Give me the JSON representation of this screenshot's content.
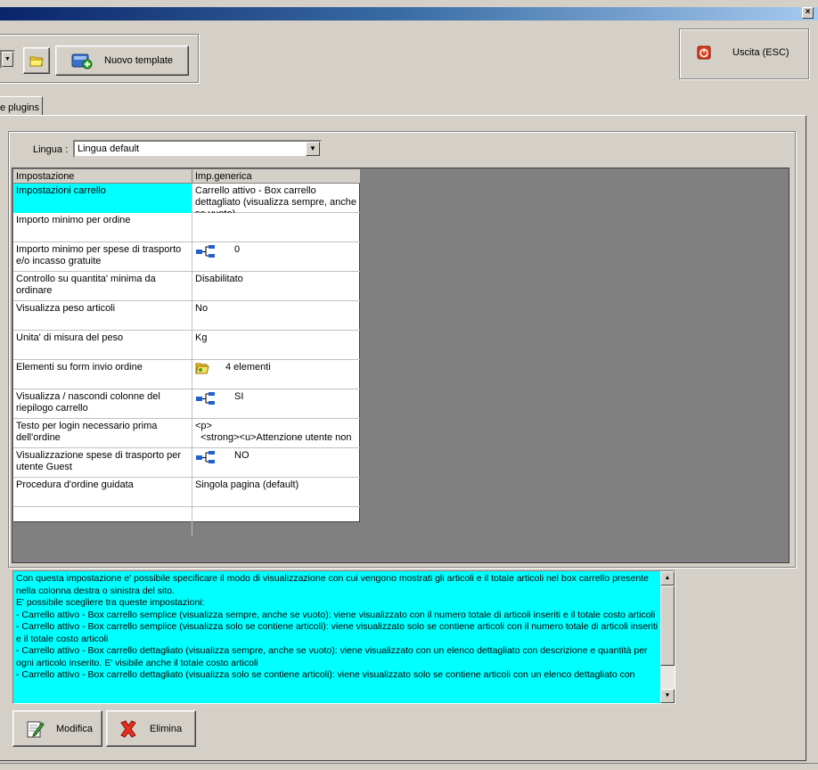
{
  "toolbar": {
    "new_template_label": "Nuovo template",
    "exit_label": "Uscita (ESC)"
  },
  "tabs": [
    {
      "label": "e plugins"
    }
  ],
  "language": {
    "label": "Lingua :",
    "value": "Lingua default"
  },
  "grid": {
    "columns": [
      "Impostazione",
      "Imp.generica"
    ],
    "rows": [
      {
        "setting": "Impostazioni carrello",
        "value": "Carrello attivo - Box carrello dettagliato (visualizza sempre, anche se vuoto)",
        "icon": ""
      },
      {
        "setting": "Importo minimo per ordine",
        "value": "",
        "icon": ""
      },
      {
        "setting": "Importo minimo per spese di trasporto e/o incasso gratuite",
        "value": "0",
        "icon": "tree-icon"
      },
      {
        "setting": "Controllo su quantita' minima da ordinare",
        "value": "Disabilitato",
        "icon": ""
      },
      {
        "setting": "Visualizza peso articoli",
        "value": "No",
        "icon": ""
      },
      {
        "setting": "Unita' di misura del peso",
        "value": "Kg",
        "icon": ""
      },
      {
        "setting": "Elementi su form invio ordine",
        "value": "4 elementi",
        "icon": "folder-icon"
      },
      {
        "setting": "Visualizza / nascondi colonne del riepilogo carrello",
        "value": "SI",
        "icon": "tree-icon"
      },
      {
        "setting": "Testo per login necessario prima dell'ordine",
        "value": "<p>\n  <strong><u>Attenzione utente non",
        "icon": ""
      },
      {
        "setting": "Visualizzazione spese di trasporto per utente Guest",
        "value": "NO",
        "icon": "tree-icon"
      },
      {
        "setting": "Procedura d'ordine guidata",
        "value": "Singola pagina (default)",
        "icon": ""
      }
    ]
  },
  "description": "Con questa impostazione e' possibile specificare il modo di visualizzazione con cui vengono mostrati gli articoli e il totale articoli nel box carrello presente nella colonna destra o sinistra del sito.\nE' possibile scegliere tra queste impostazioni:\n- Carrello attivo - Box carrello semplice (visualizza sempre, anche se vuoto): viene visualizzato con il numero totale di articoli inseriti e il totale costo articoli\n- Carrello attivo - Box carrello semplice (visualizza solo se contiene articoli): viene visualizzato solo se contiene articoli con il numero totale di articoli inseriti e il totale costo articoli\n- Carrello attivo - Box carrello dettagliato (visualizza sempre, anche se vuoto): viene visualizzato con un elenco dettagliato con descrizione e quantità per ogni articolo inserito. E' visibile anche il totale costo articoli\n- Carrello attivo - Box carrello dettagliato (visualizza solo se contiene articoli): viene visualizzato solo se contiene articoli con un elenco dettagliato con",
  "actions": {
    "edit_label": "Modifica",
    "delete_label": "Elimina"
  },
  "colors": {
    "selection": "#00ffff",
    "window_bg": "#d4d0c8",
    "grid_bg": "#808080"
  }
}
